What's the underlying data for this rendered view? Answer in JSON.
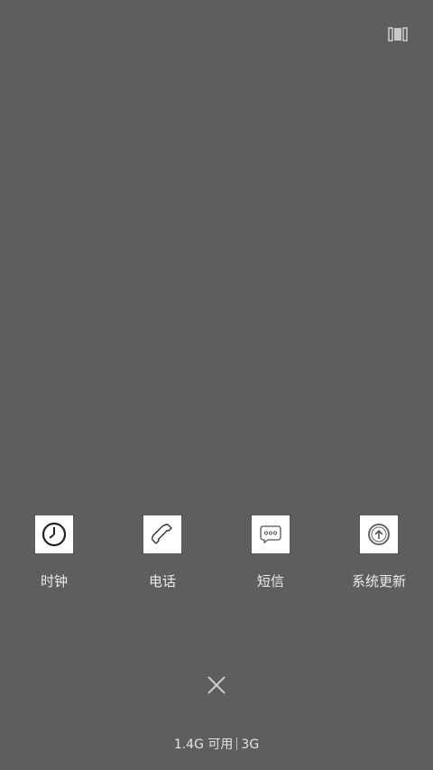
{
  "header": {
    "view_toggle_icon": "grid-view-icon"
  },
  "apps": [
    {
      "label": "时钟",
      "icon": "clock-icon"
    },
    {
      "label": "电话",
      "icon": "phone-icon"
    },
    {
      "label": "短信",
      "icon": "message-icon"
    },
    {
      "label": "系统更新",
      "icon": "system-update-icon"
    }
  ],
  "close": {
    "icon": "close-icon"
  },
  "memory": {
    "available": "1.4G 可用",
    "total": "3G"
  },
  "colors": {
    "background": "#5e5e5e",
    "label_text": "#ececec",
    "icon_tile": "#ffffff"
  }
}
